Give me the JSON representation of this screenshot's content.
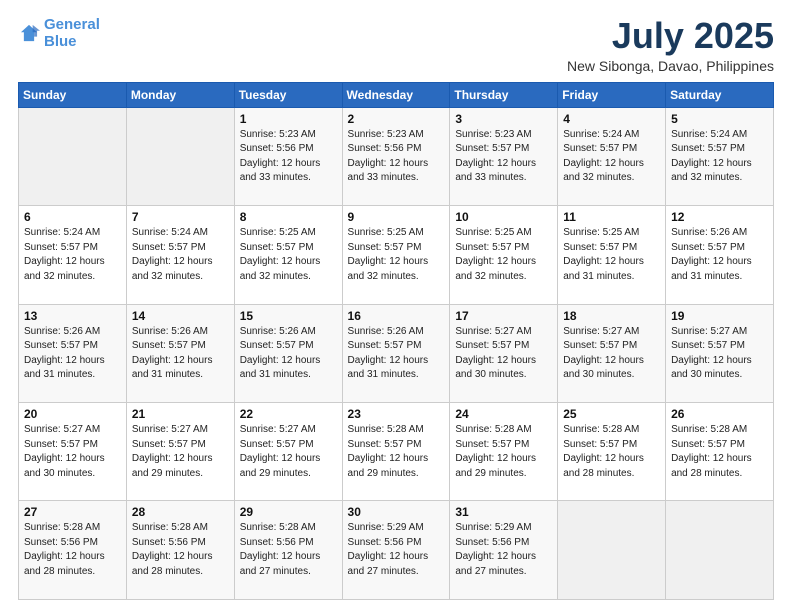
{
  "logo": {
    "line1": "General",
    "line2": "Blue"
  },
  "title": "July 2025",
  "subtitle": "New Sibonga, Davao, Philippines",
  "days_header": [
    "Sunday",
    "Monday",
    "Tuesday",
    "Wednesday",
    "Thursday",
    "Friday",
    "Saturday"
  ],
  "weeks": [
    [
      {
        "day": "",
        "info": ""
      },
      {
        "day": "",
        "info": ""
      },
      {
        "day": "1",
        "info": "Sunrise: 5:23 AM\nSunset: 5:56 PM\nDaylight: 12 hours\nand 33 minutes."
      },
      {
        "day": "2",
        "info": "Sunrise: 5:23 AM\nSunset: 5:56 PM\nDaylight: 12 hours\nand 33 minutes."
      },
      {
        "day": "3",
        "info": "Sunrise: 5:23 AM\nSunset: 5:57 PM\nDaylight: 12 hours\nand 33 minutes."
      },
      {
        "day": "4",
        "info": "Sunrise: 5:24 AM\nSunset: 5:57 PM\nDaylight: 12 hours\nand 32 minutes."
      },
      {
        "day": "5",
        "info": "Sunrise: 5:24 AM\nSunset: 5:57 PM\nDaylight: 12 hours\nand 32 minutes."
      }
    ],
    [
      {
        "day": "6",
        "info": "Sunrise: 5:24 AM\nSunset: 5:57 PM\nDaylight: 12 hours\nand 32 minutes."
      },
      {
        "day": "7",
        "info": "Sunrise: 5:24 AM\nSunset: 5:57 PM\nDaylight: 12 hours\nand 32 minutes."
      },
      {
        "day": "8",
        "info": "Sunrise: 5:25 AM\nSunset: 5:57 PM\nDaylight: 12 hours\nand 32 minutes."
      },
      {
        "day": "9",
        "info": "Sunrise: 5:25 AM\nSunset: 5:57 PM\nDaylight: 12 hours\nand 32 minutes."
      },
      {
        "day": "10",
        "info": "Sunrise: 5:25 AM\nSunset: 5:57 PM\nDaylight: 12 hours\nand 32 minutes."
      },
      {
        "day": "11",
        "info": "Sunrise: 5:25 AM\nSunset: 5:57 PM\nDaylight: 12 hours\nand 31 minutes."
      },
      {
        "day": "12",
        "info": "Sunrise: 5:26 AM\nSunset: 5:57 PM\nDaylight: 12 hours\nand 31 minutes."
      }
    ],
    [
      {
        "day": "13",
        "info": "Sunrise: 5:26 AM\nSunset: 5:57 PM\nDaylight: 12 hours\nand 31 minutes."
      },
      {
        "day": "14",
        "info": "Sunrise: 5:26 AM\nSunset: 5:57 PM\nDaylight: 12 hours\nand 31 minutes."
      },
      {
        "day": "15",
        "info": "Sunrise: 5:26 AM\nSunset: 5:57 PM\nDaylight: 12 hours\nand 31 minutes."
      },
      {
        "day": "16",
        "info": "Sunrise: 5:26 AM\nSunset: 5:57 PM\nDaylight: 12 hours\nand 31 minutes."
      },
      {
        "day": "17",
        "info": "Sunrise: 5:27 AM\nSunset: 5:57 PM\nDaylight: 12 hours\nand 30 minutes."
      },
      {
        "day": "18",
        "info": "Sunrise: 5:27 AM\nSunset: 5:57 PM\nDaylight: 12 hours\nand 30 minutes."
      },
      {
        "day": "19",
        "info": "Sunrise: 5:27 AM\nSunset: 5:57 PM\nDaylight: 12 hours\nand 30 minutes."
      }
    ],
    [
      {
        "day": "20",
        "info": "Sunrise: 5:27 AM\nSunset: 5:57 PM\nDaylight: 12 hours\nand 30 minutes."
      },
      {
        "day": "21",
        "info": "Sunrise: 5:27 AM\nSunset: 5:57 PM\nDaylight: 12 hours\nand 29 minutes."
      },
      {
        "day": "22",
        "info": "Sunrise: 5:27 AM\nSunset: 5:57 PM\nDaylight: 12 hours\nand 29 minutes."
      },
      {
        "day": "23",
        "info": "Sunrise: 5:28 AM\nSunset: 5:57 PM\nDaylight: 12 hours\nand 29 minutes."
      },
      {
        "day": "24",
        "info": "Sunrise: 5:28 AM\nSunset: 5:57 PM\nDaylight: 12 hours\nand 29 minutes."
      },
      {
        "day": "25",
        "info": "Sunrise: 5:28 AM\nSunset: 5:57 PM\nDaylight: 12 hours\nand 28 minutes."
      },
      {
        "day": "26",
        "info": "Sunrise: 5:28 AM\nSunset: 5:57 PM\nDaylight: 12 hours\nand 28 minutes."
      }
    ],
    [
      {
        "day": "27",
        "info": "Sunrise: 5:28 AM\nSunset: 5:56 PM\nDaylight: 12 hours\nand 28 minutes."
      },
      {
        "day": "28",
        "info": "Sunrise: 5:28 AM\nSunset: 5:56 PM\nDaylight: 12 hours\nand 28 minutes."
      },
      {
        "day": "29",
        "info": "Sunrise: 5:28 AM\nSunset: 5:56 PM\nDaylight: 12 hours\nand 27 minutes."
      },
      {
        "day": "30",
        "info": "Sunrise: 5:29 AM\nSunset: 5:56 PM\nDaylight: 12 hours\nand 27 minutes."
      },
      {
        "day": "31",
        "info": "Sunrise: 5:29 AM\nSunset: 5:56 PM\nDaylight: 12 hours\nand 27 minutes."
      },
      {
        "day": "",
        "info": ""
      },
      {
        "day": "",
        "info": ""
      }
    ]
  ]
}
